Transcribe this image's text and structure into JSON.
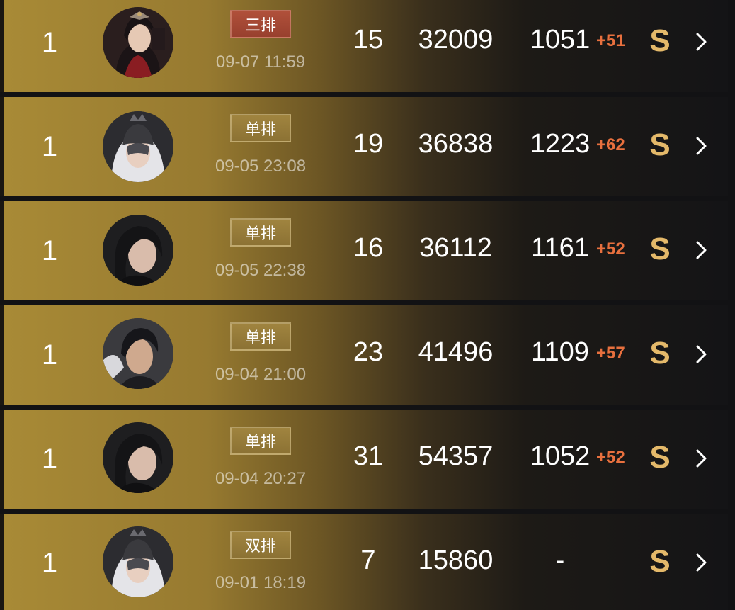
{
  "records": [
    {
      "rank": "1",
      "mode": "三排",
      "mode_color": "#a8483a",
      "time": "09-07 11:59",
      "kills": "15",
      "score": "32009",
      "rating": "1051",
      "delta": "+51",
      "grade": "S",
      "avatar": "female-hero-avatar-red"
    },
    {
      "rank": "1",
      "mode": "单排",
      "mode_color": "#967b3a",
      "time": "09-05 23:08",
      "kills": "19",
      "score": "36838",
      "rating": "1223",
      "delta": "+62",
      "grade": "S",
      "avatar": "masked-hero-avatar"
    },
    {
      "rank": "1",
      "mode": "单排",
      "mode_color": "#967b3a",
      "time": "09-05 22:38",
      "kills": "16",
      "score": "36112",
      "rating": "1161",
      "delta": "+52",
      "grade": "S",
      "avatar": "dark-hair-hero-avatar"
    },
    {
      "rank": "1",
      "mode": "单排",
      "mode_color": "#967b3a",
      "time": "09-04 21:00",
      "kills": "23",
      "score": "41496",
      "rating": "1109",
      "delta": "+57",
      "grade": "S",
      "avatar": "male-hero-avatar"
    },
    {
      "rank": "1",
      "mode": "单排",
      "mode_color": "#967b3a",
      "time": "09-04 20:27",
      "kills": "31",
      "score": "54357",
      "rating": "1052",
      "delta": "+52",
      "grade": "S",
      "avatar": "dark-hair-hero-avatar"
    },
    {
      "rank": "1",
      "mode": "双排",
      "mode_color": "#967b3a",
      "time": "09-01 18:19",
      "kills": "7",
      "score": "15860",
      "rating": "-",
      "delta": "",
      "grade": "S",
      "avatar": "masked-hero-avatar"
    }
  ],
  "colors": {
    "delta": "#e8703e",
    "grade": "#e4b96a",
    "gold": "#a88a36"
  }
}
